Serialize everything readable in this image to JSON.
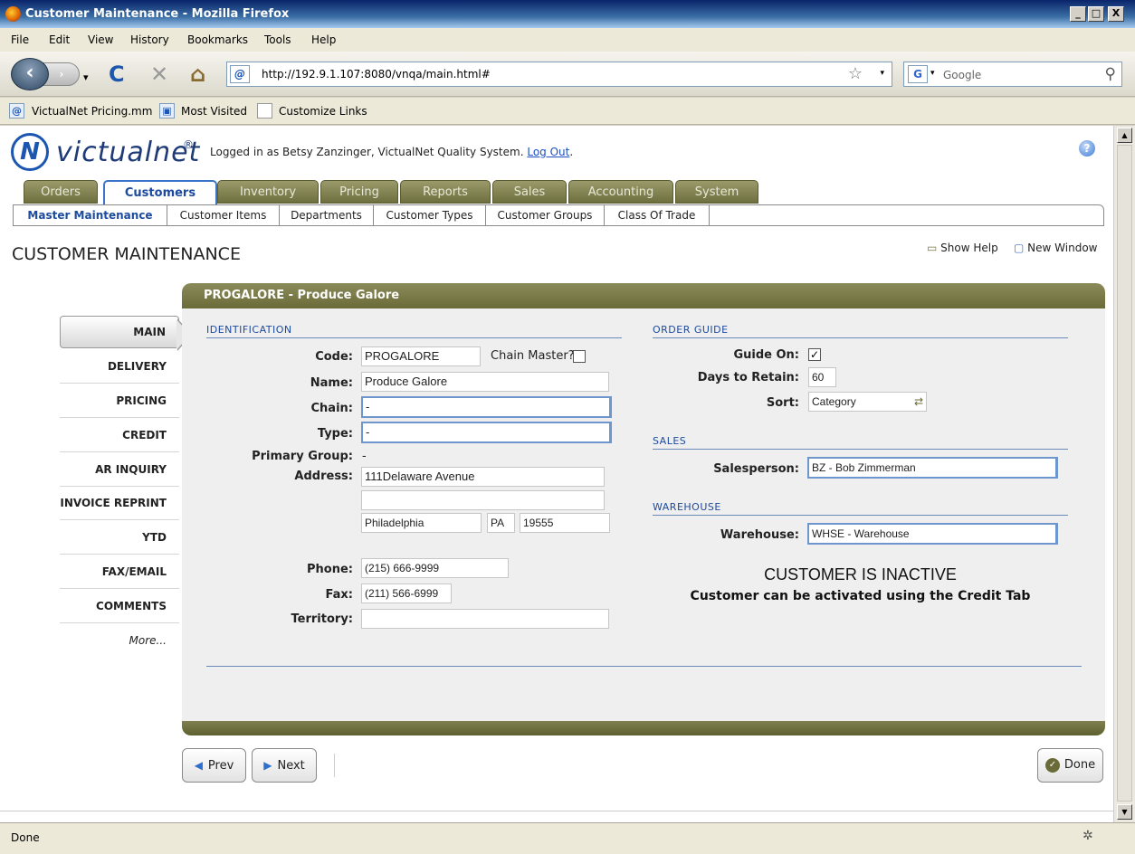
{
  "window": {
    "title": "Customer Maintenance - Mozilla Firefox",
    "min": "_",
    "max": "□",
    "close": "X"
  },
  "menu": [
    "File",
    "Edit",
    "View",
    "History",
    "Bookmarks",
    "Tools",
    "Help"
  ],
  "nav": {
    "url": "http://192.9.1.107:8080/vnqa/main.html#",
    "search_placeholder": "Google",
    "back_icon": "‹",
    "fwd_icon": "›",
    "reload_icon": "C",
    "stop_icon": "✕",
    "home_icon": "⌂",
    "star_icon": "☆",
    "drop_icon": "▾",
    "search_icon": "⚲",
    "engine_icon": "G",
    "site_icon": "@"
  },
  "bookmarks": [
    "VictualNet Pricing.mm",
    "Most Visited",
    "Customize Links"
  ],
  "app": {
    "logo_text": "victualnet",
    "logo_n": "N",
    "logo_reg": "®",
    "logged_in": "Logged in as Betsy Zanzinger, VictualNet Quality System.",
    "logout": "Log Out",
    "logout_suffix": ".",
    "help_icon": "?",
    "tabs": [
      "Orders",
      "Customers",
      "Inventory",
      "Pricing",
      "Reports",
      "Sales",
      "Accounting",
      "System"
    ],
    "subtabs": [
      "Master Maintenance",
      "Customer Items",
      "Departments",
      "Customer Types",
      "Customer Groups",
      "Class Of Trade"
    ],
    "page_title": "CUSTOMER MAINTENANCE",
    "show_help": "Show Help",
    "new_window": "New Window"
  },
  "panel": {
    "title": "PROGALORE - Produce Galore"
  },
  "left_nav": [
    "MAIN",
    "DELIVERY",
    "PRICING",
    "CREDIT",
    "AR INQUIRY",
    "INVOICE REPRINT",
    "YTD",
    "FAX/EMAIL",
    "COMMENTS"
  ],
  "left_nav_more": "More...",
  "identification": {
    "heading": "IDENTIFICATION",
    "code_label": "Code:",
    "code": "PROGALORE",
    "chain_master_label": "Chain Master?",
    "chain_master": false,
    "name_label": "Name:",
    "name": "Produce Galore",
    "chain_label": "Chain:",
    "chain": "-",
    "type_label": "Type:",
    "type": "-",
    "primary_group_label": "Primary Group:",
    "primary_group": "-",
    "address_label": "Address:",
    "address1": "111Delaware Avenue",
    "address2": "",
    "city": "Philadelphia",
    "state": "PA",
    "zip": "19555",
    "phone_label": "Phone:",
    "phone": "(215) 666-9999",
    "fax_label": "Fax:",
    "fax": "(211) 566-6999",
    "territory_label": "Territory:",
    "territory": ""
  },
  "order_guide": {
    "heading": "ORDER GUIDE",
    "guide_on_label": "Guide On:",
    "guide_on": true,
    "days_label": "Days to Retain:",
    "days": "60",
    "sort_label": "Sort:",
    "sort": "Category"
  },
  "sales": {
    "heading": "SALES",
    "salesperson_label": "Salesperson:",
    "salesperson": "BZ - Bob Zimmerman"
  },
  "warehouse": {
    "heading": "WAREHOUSE",
    "warehouse_label": "Warehouse:",
    "warehouse": "WHSE - Warehouse"
  },
  "notice": {
    "title": "CUSTOMER IS INACTIVE",
    "subtitle": "Customer can be activated using the Credit Tab"
  },
  "buttons": {
    "prev": "Prev",
    "next": "Next",
    "done": "Done"
  },
  "status": "Done"
}
